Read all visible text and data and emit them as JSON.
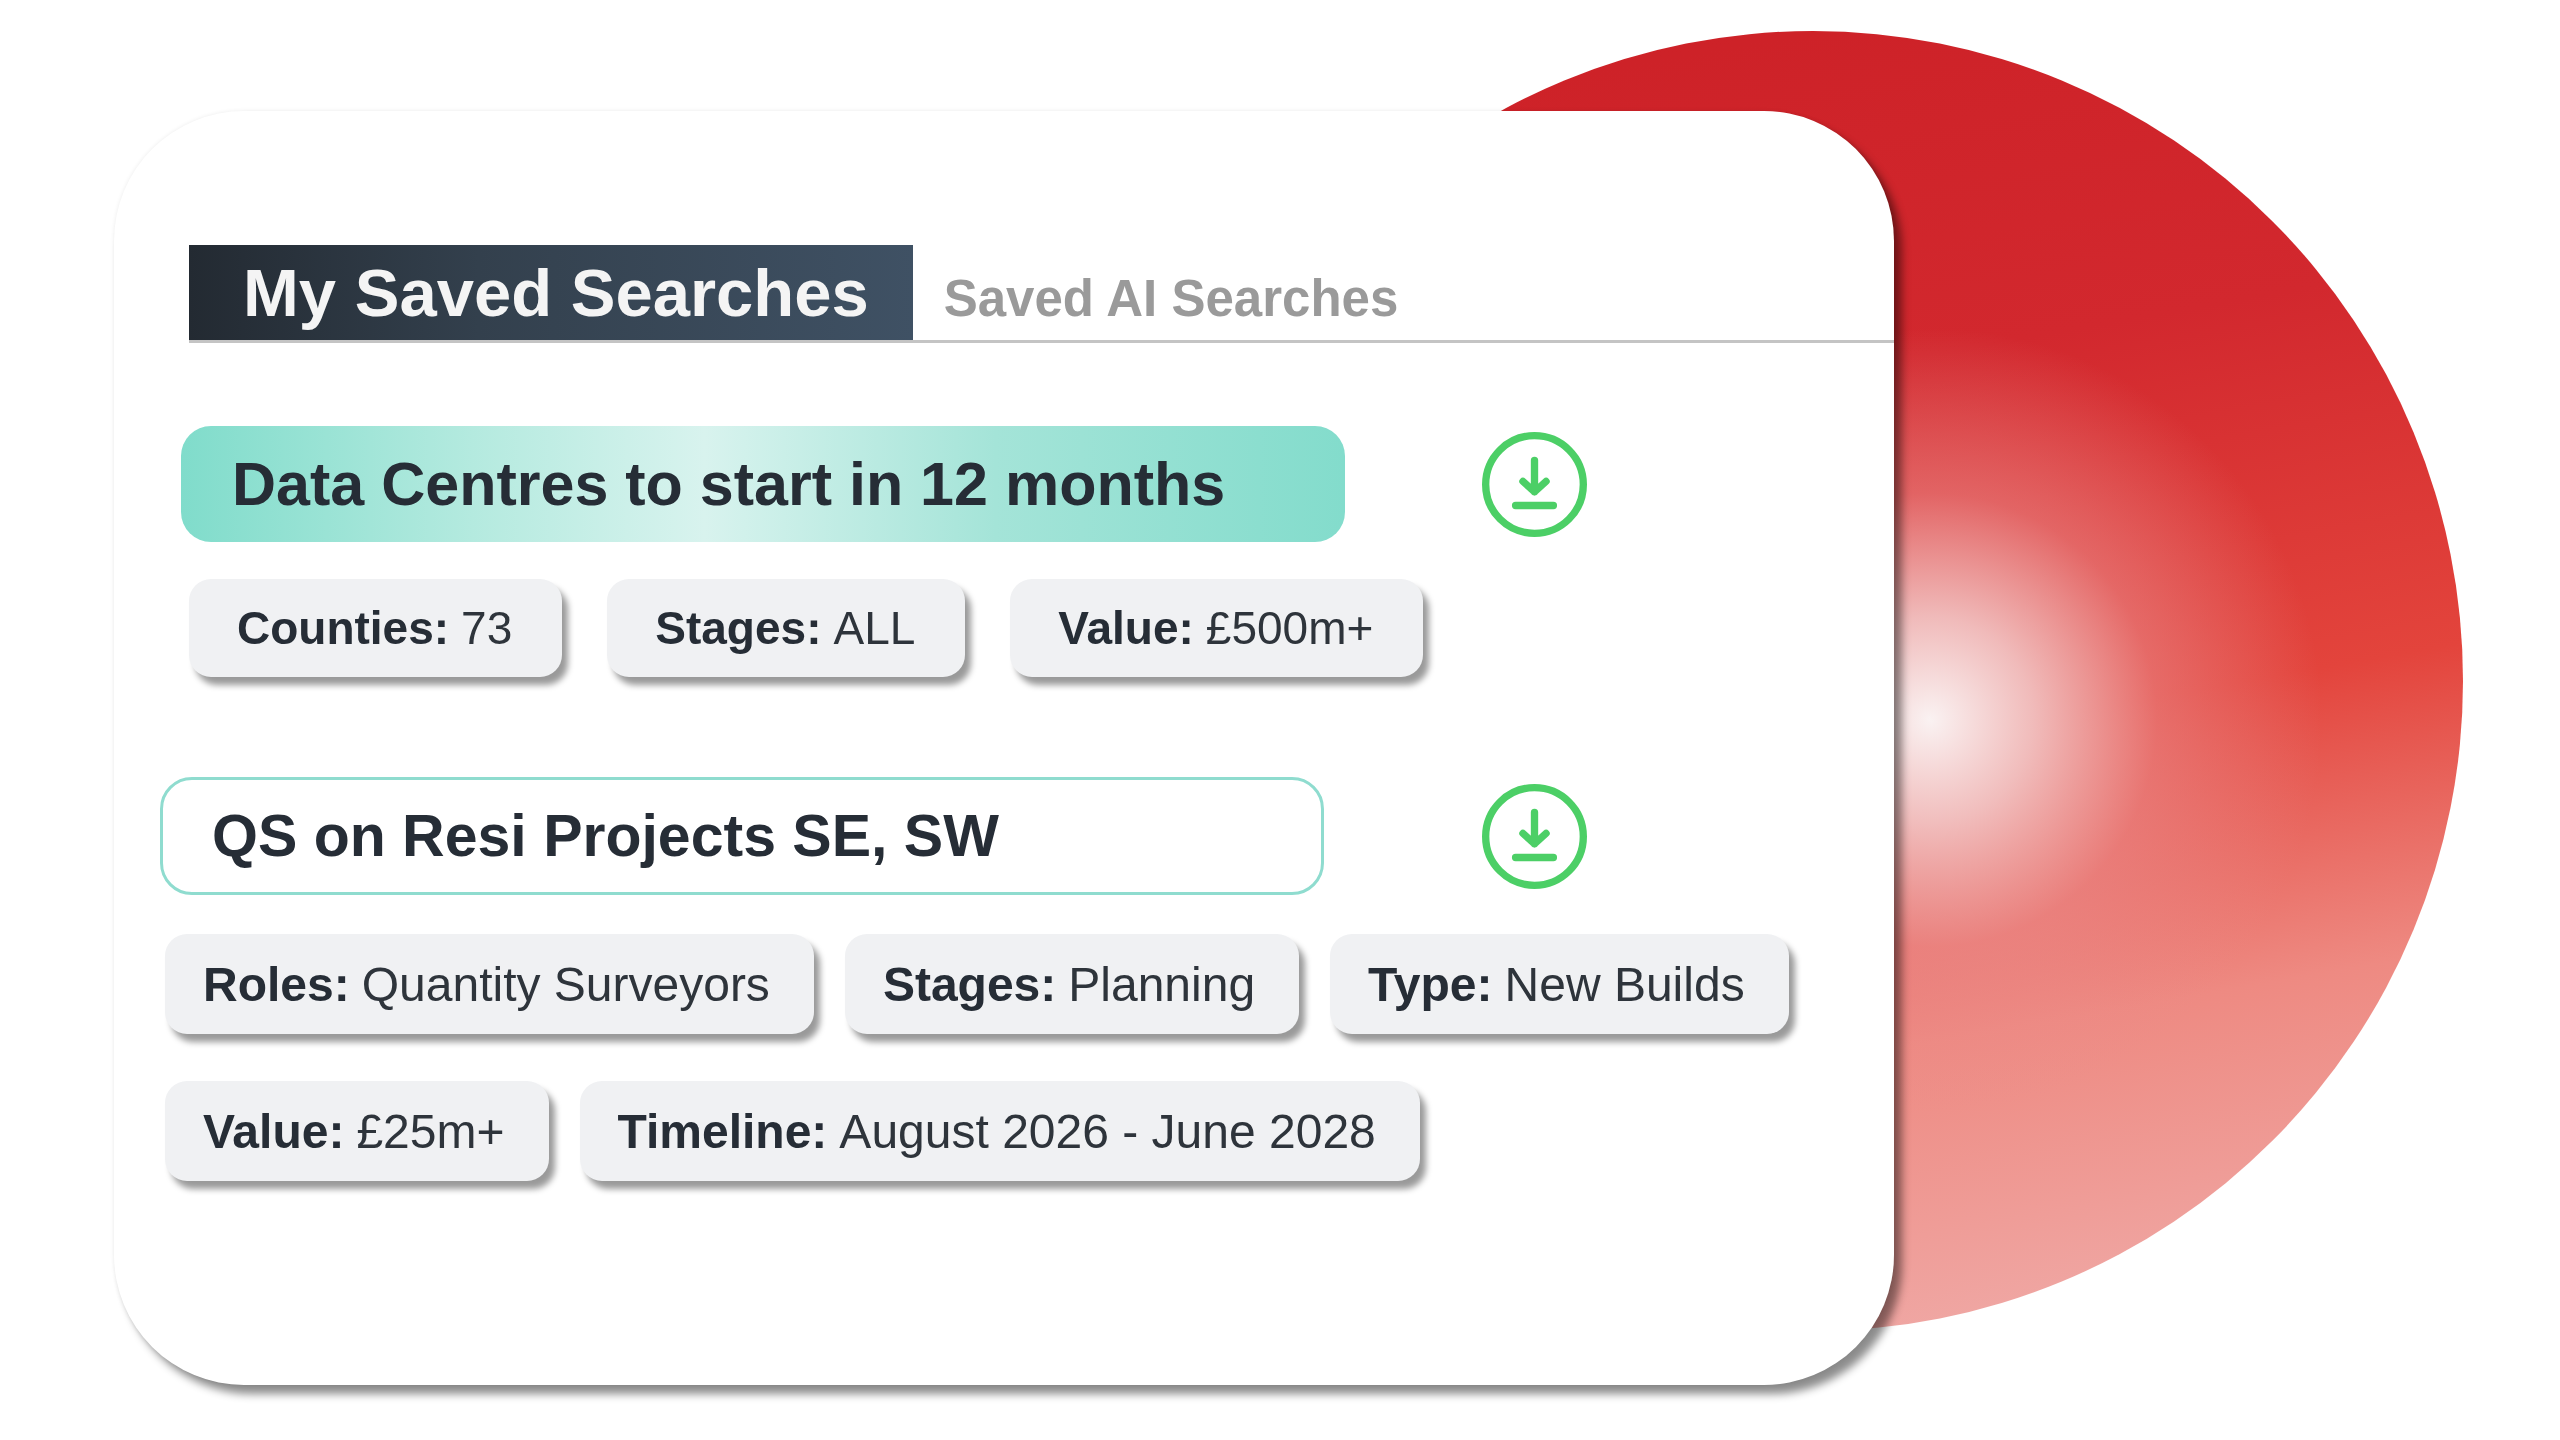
{
  "tabs": [
    {
      "label": "My Saved Searches",
      "selected": true
    },
    {
      "label": "Saved AI Searches",
      "selected": false
    }
  ],
  "saved_searches": [
    {
      "title": "Data Centres to start in 12 months",
      "selected": true,
      "filters": [
        {
          "label": "Counties:",
          "value": "73"
        },
        {
          "label": "Stages:",
          "value": "ALL"
        },
        {
          "label": "Value:",
          "value": "£500m+"
        }
      ]
    },
    {
      "title": "QS on Resi Projects SE, SW",
      "selected": false,
      "filters": [
        {
          "label": "Roles:",
          "value": "Quantity Surveyors"
        },
        {
          "label": "Stages:",
          "value": "Planning"
        },
        {
          "label": "Type:",
          "value": "New Builds"
        },
        {
          "label": "Value:",
          "value": "£25m+"
        },
        {
          "label": "Timeline:",
          "value": "August 2026 - June 2028"
        }
      ]
    }
  ]
}
